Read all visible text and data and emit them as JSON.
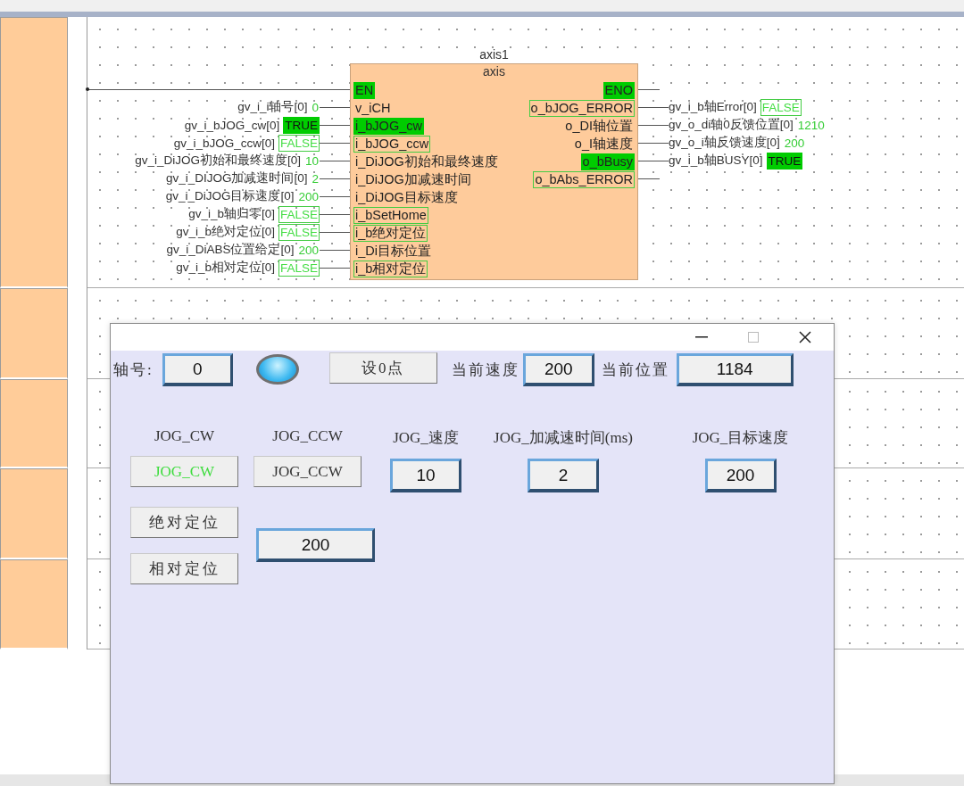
{
  "block": {
    "instance": "axis1",
    "type": "axis",
    "inputs": [
      {
        "kind": "enable",
        "pin": {
          "label": "EN",
          "kind": "bool",
          "on": true
        }
      },
      {
        "kind": "linked",
        "pin": {
          "label": "v_iCH",
          "kind": "plain"
        },
        "variable": "gv_i_i轴号[0]",
        "value": {
          "text": "0",
          "kind": "number"
        }
      },
      {
        "kind": "linked",
        "pin": {
          "label": "i_bJOG_cw",
          "kind": "bool",
          "on": true
        },
        "variable": "gv_i_bJOG_cw[0]",
        "value": {
          "text": "TRUE",
          "kind": "bool",
          "on": true
        }
      },
      {
        "kind": "linked",
        "pin": {
          "label": "i_bJOG_ccw",
          "kind": "bool",
          "on": false
        },
        "variable": "gv_i_bJOG_ccw[0]",
        "value": {
          "text": "FALSE",
          "kind": "bool",
          "on": false
        }
      },
      {
        "kind": "linked",
        "pin": {
          "label": "i_DiJOG初始和最终速度",
          "kind": "plain"
        },
        "variable": "gv_i_DiJOG初始和最终速度[0]",
        "value": {
          "text": "10",
          "kind": "number"
        }
      },
      {
        "kind": "linked",
        "pin": {
          "label": "i_DiJOG加减速时间",
          "kind": "plain"
        },
        "variable": "gv_i_DIJOG加减速时间[0]",
        "value": {
          "text": "2",
          "kind": "number"
        }
      },
      {
        "kind": "linked",
        "pin": {
          "label": "i_DiJOG目标速度",
          "kind": "plain"
        },
        "variable": "gv_i_DiJOG目标速度[0]",
        "value": {
          "text": "200",
          "kind": "number"
        }
      },
      {
        "kind": "linked",
        "pin": {
          "label": "i_bSetHome",
          "kind": "bool",
          "on": false
        },
        "variable": "gv_i_b轴归零[0]",
        "value": {
          "text": "FALSE",
          "kind": "bool",
          "on": false
        }
      },
      {
        "kind": "linked",
        "pin": {
          "label": "i_b绝对定位",
          "kind": "bool",
          "on": false
        },
        "variable": "gv_i_b绝对定位[0]",
        "value": {
          "text": "FALSE",
          "kind": "bool",
          "on": false
        }
      },
      {
        "kind": "linked",
        "pin": {
          "label": "i_Di目标位置",
          "kind": "plain"
        },
        "variable": "gv_i_DiABS位置给定[0]",
        "value": {
          "text": "200",
          "kind": "number"
        }
      },
      {
        "kind": "linked",
        "pin": {
          "label": "i_b相对定位",
          "kind": "bool",
          "on": false
        },
        "variable": "gv_i_b相对定位[0]",
        "value": {
          "text": "FALSE",
          "kind": "bool",
          "on": false
        }
      }
    ],
    "outputs": [
      {
        "kind": "stub",
        "pin": {
          "label": "ENO",
          "kind": "bool",
          "on": true
        }
      },
      {
        "kind": "linked",
        "pin": {
          "label": "o_bJOG_ERROR",
          "kind": "bool",
          "on": false
        },
        "variable": "gv_i_b轴Error[0]",
        "value": {
          "text": "FALSE",
          "kind": "bool",
          "on": false
        }
      },
      {
        "kind": "linked",
        "pin": {
          "label": "o_DI轴位置",
          "kind": "plain"
        },
        "variable": "gv_o_di轴0反馈位置[0]",
        "value": {
          "text": "1210",
          "kind": "number"
        }
      },
      {
        "kind": "linked",
        "pin": {
          "label": "o_I轴速度",
          "kind": "plain"
        },
        "variable": "gv_o_i轴反馈速度[0]",
        "value": {
          "text": "200",
          "kind": "number"
        }
      },
      {
        "kind": "linked",
        "pin": {
          "label": "o_bBusy",
          "kind": "bool",
          "on": true
        },
        "variable": "gv_i_b轴BUSY[0]",
        "value": {
          "text": "TRUE",
          "kind": "bool",
          "on": true
        }
      },
      {
        "kind": "stub",
        "pin": {
          "label": "o_bAbs_ERROR",
          "kind": "bool",
          "on": false
        }
      }
    ]
  },
  "dialog": {
    "window_controls": [
      {
        "kind": "minimize",
        "disabled": false
      },
      {
        "kind": "maximize",
        "disabled": true
      },
      {
        "kind": "close",
        "disabled": false
      }
    ],
    "axis_label": "轴号:",
    "axis_value": "0",
    "lamp_on": true,
    "set_zero": "设0点",
    "speed_label": "当前速度",
    "speed_value": "200",
    "position_label": "当前位置",
    "position_value": "1184",
    "jog_columns": [
      {
        "label": "JOG_CW",
        "kind": "button",
        "text": "JOG_CW",
        "active": true
      },
      {
        "label": "JOG_CCW",
        "kind": "button",
        "text": "JOG_CCW",
        "active": false
      },
      {
        "label": "JOG_速度",
        "kind": "field",
        "value": "10"
      },
      {
        "label": "JOG_加减速时间(ms)",
        "kind": "field",
        "value": "2"
      },
      {
        "label": "JOG_目标速度",
        "kind": "field",
        "value": "200"
      }
    ],
    "positioning": {
      "buttons": [
        "绝对定位",
        "相对定位"
      ],
      "value": "200"
    }
  }
}
